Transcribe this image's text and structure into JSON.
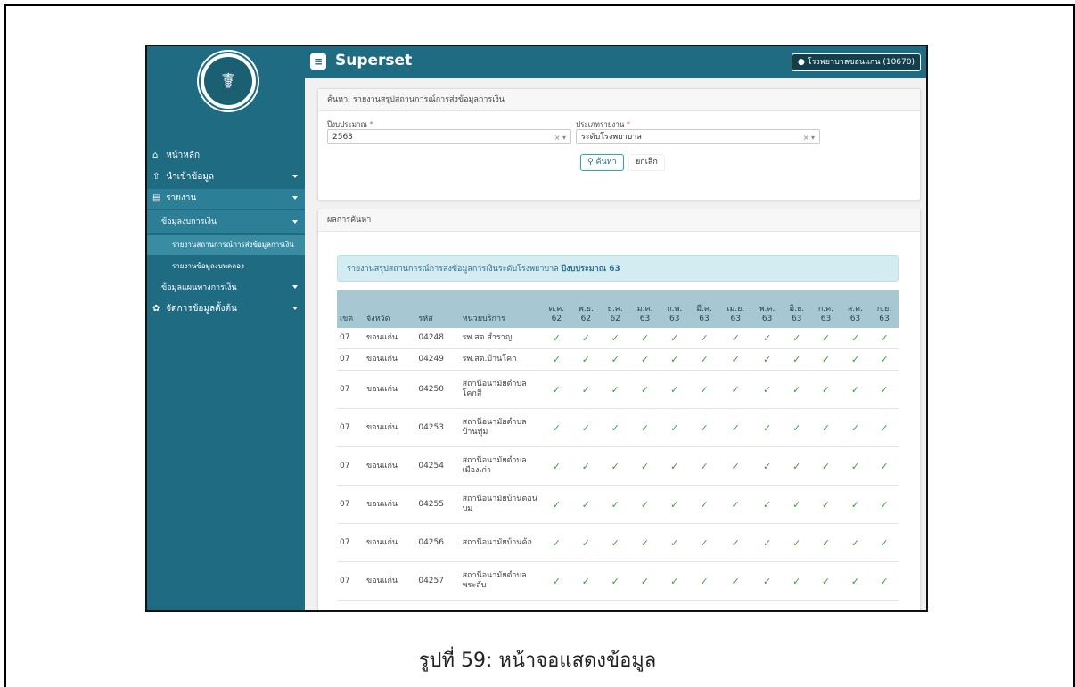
{
  "app": {
    "brand": "Superset",
    "menu_icon": "hamburger-icon",
    "user_label": "โรงพยาบาลขอนแก่น (10670)",
    "user_icon": "user-circle-icon"
  },
  "logo": {
    "label": "MINISTRY OF PUBLIC HEALTH"
  },
  "sidebar": {
    "items": [
      {
        "label": "หน้าหลัก",
        "icon": "home-icon"
      },
      {
        "label": "นำเข้าข้อมูล",
        "icon": "upload-icon"
      },
      {
        "label": "รายงาน",
        "icon": "file-icon"
      },
      {
        "label": "ข้อมูลงบการเงิน"
      },
      {
        "label": "รายงานสถานการณ์การส่งข้อมูลการเงิน"
      },
      {
        "label": "รายงานข้อมูลงบทดลอง"
      },
      {
        "label": "ข้อมูลแผนทางการเงิน"
      },
      {
        "label": "จัดการข้อมูลตั้งต้น",
        "icon": "gear-icon"
      }
    ]
  },
  "search": {
    "title": "ค้นหา: รายงานสรุปสถานการณ์การส่งข้อมูลการเงิน",
    "year_label": "ปีงบประมาณ",
    "year_value": "2563",
    "type_label": "ประเภทรายงาน",
    "type_value": "ระดับโรงพยาบาล",
    "required_mark": "*",
    "clear_mark": "×",
    "search_button": "ค้นหา",
    "cancel_button": "ยกเลิก"
  },
  "results": {
    "title": "ผลการค้นหา",
    "banner_text": "รายงานสรุปสถานการณ์การส่งข้อมูลการเงินระดับโรงพยาบาล",
    "banner_bold": "ปีงบประมาณ 63",
    "columns": [
      "เขต",
      "จังหวัด",
      "รหัส",
      "หน่วยบริการ"
    ],
    "months": [
      "ต.ค.\n62",
      "พ.ย.\n62",
      "ธ.ค.\n62",
      "ม.ค.\n63",
      "ก.พ.\n63",
      "มี.ค.\n63",
      "เม.ย.\n63",
      "พ.ค.\n63",
      "มิ.ย.\n63",
      "ก.ค.\n63",
      "ส.ค.\n63",
      "ก.ย.\n63"
    ],
    "check_glyph": "✓",
    "rows": [
      {
        "zone": "07",
        "province": "ขอนแก่น",
        "code": "04248",
        "unit": "รพ.สต.สำราญ"
      },
      {
        "zone": "07",
        "province": "ขอนแก่น",
        "code": "04249",
        "unit": "รพ.สต.บ้านโคก"
      },
      {
        "zone": "07",
        "province": "ขอนแก่น",
        "code": "04250",
        "unit": "สถานีอนามัยตำบลโคกสี"
      },
      {
        "zone": "07",
        "province": "ขอนแก่น",
        "code": "04253",
        "unit": "สถานีอนามัยตำบลบ้านทุ่ม"
      },
      {
        "zone": "07",
        "province": "ขอนแก่น",
        "code": "04254",
        "unit": "สถานีอนามัยตำบลเมืองเก่า"
      },
      {
        "zone": "07",
        "province": "ขอนแก่น",
        "code": "04255",
        "unit": "สถานีอนามัยบ้านดอนบม"
      },
      {
        "zone": "07",
        "province": "ขอนแก่น",
        "code": "04256",
        "unit": "สถานีอนามัยบ้านค้อ"
      },
      {
        "zone": "07",
        "province": "ขอนแก่น",
        "code": "04257",
        "unit": "สถานีอนามัยตำบลพระลับ"
      }
    ]
  },
  "caption": "รูปที่ 59: หน้าจอแสดงข้อมูล"
}
